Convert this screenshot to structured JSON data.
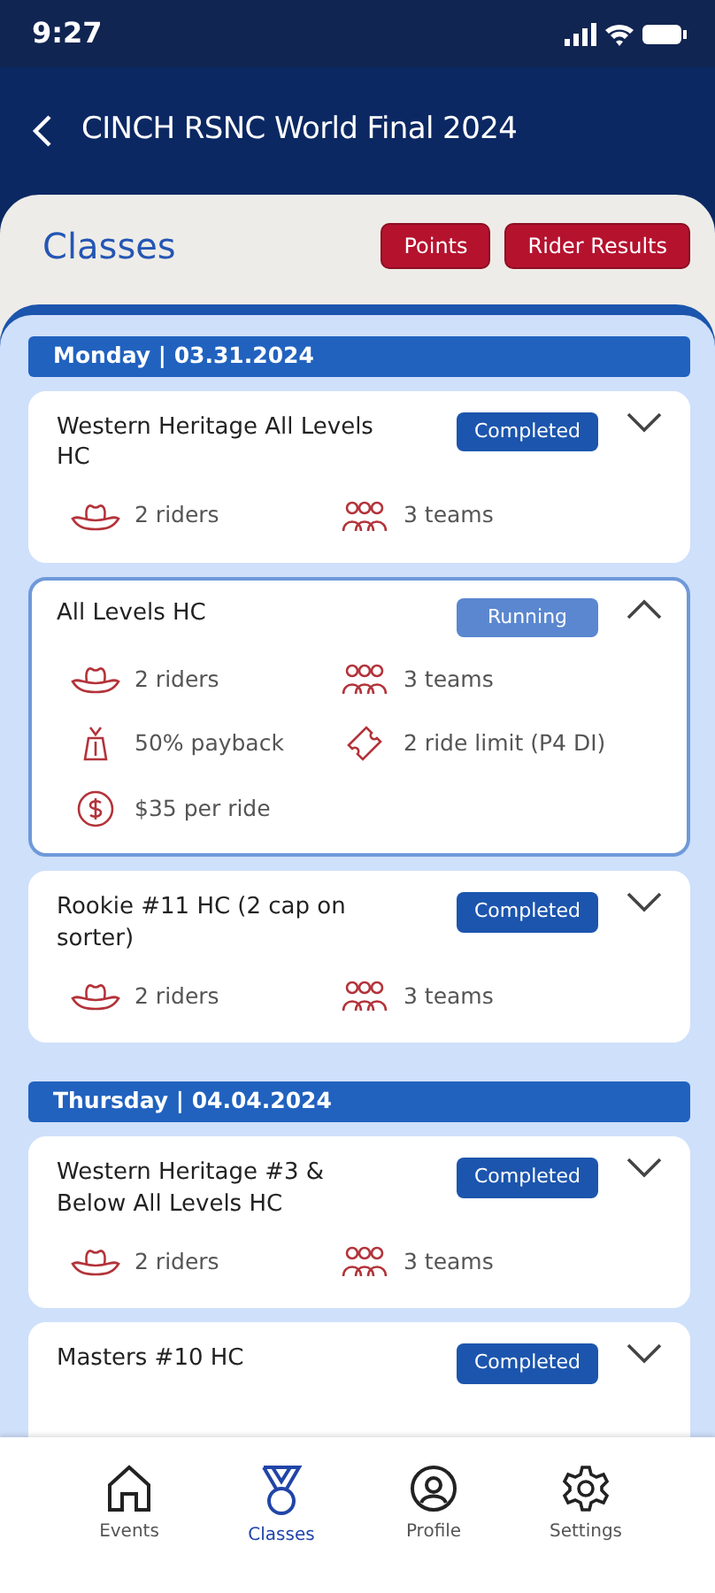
{
  "status_bar": {
    "time": "9:27"
  },
  "header": {
    "title": "CINCH RSNC World Final 2024"
  },
  "section": {
    "title": "Classes",
    "buttons": [
      "Points",
      "Rider Results"
    ]
  },
  "days": [
    {
      "label": "Monday | 03.31.2024",
      "classes": [
        {
          "name": "Western Heritage All Levels HC",
          "status": "Completed",
          "running": false,
          "expanded": false,
          "stats": [
            {
              "kind": "riders",
              "text": "2 riders"
            },
            {
              "kind": "teams",
              "text": "3 teams"
            }
          ]
        },
        {
          "name": "All Levels HC",
          "status": "Running",
          "running": true,
          "expanded": true,
          "stats": [
            {
              "kind": "riders",
              "text": "2 riders"
            },
            {
              "kind": "teams",
              "text": "3 teams"
            },
            {
              "kind": "payback",
              "text": "50% payback"
            },
            {
              "kind": "limit",
              "text": "2 ride limit (P4 DI)"
            },
            {
              "kind": "price",
              "text": "$35 per ride"
            }
          ]
        },
        {
          "name": "Rookie #11 HC (2 cap on sorter)",
          "status": "Completed",
          "running": false,
          "expanded": false,
          "stats": [
            {
              "kind": "riders",
              "text": "2 riders"
            },
            {
              "kind": "teams",
              "text": "3 teams"
            }
          ]
        }
      ]
    },
    {
      "label": "Thursday | 04.04.2024",
      "classes": [
        {
          "name": "Western Heritage #3 & Below All Levels HC",
          "status": "Completed",
          "running": false,
          "expanded": false,
          "stats": [
            {
              "kind": "riders",
              "text": "2 riders"
            },
            {
              "kind": "teams",
              "text": "3 teams"
            }
          ]
        },
        {
          "name": "Masters #10 HC",
          "status": "Completed",
          "running": false,
          "expanded": false
        }
      ]
    }
  ],
  "bottom_nav": [
    {
      "label": "Events",
      "kind": "home",
      "selected": false
    },
    {
      "label": "Classes",
      "kind": "medal",
      "selected": true
    },
    {
      "label": "Profile",
      "kind": "profile",
      "selected": false
    },
    {
      "label": "Settings",
      "kind": "gear",
      "selected": false
    }
  ]
}
